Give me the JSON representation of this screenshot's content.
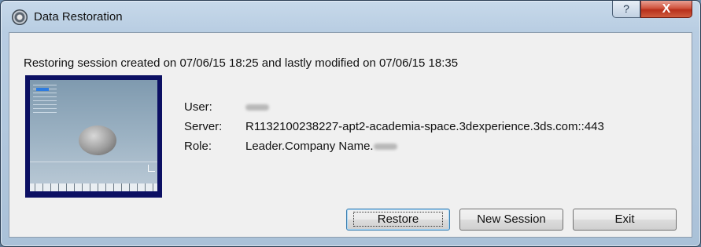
{
  "window": {
    "title": "Data Restoration",
    "help_label": "?",
    "close_label": "X"
  },
  "message": "Restoring session created on 07/06/15 18:25 and lastly modified on 07/06/15 18:35",
  "info": {
    "user_label": "User:",
    "server_label": "Server:",
    "server_value": "R1132100238227-apt2-academia-space.3dexperience.3ds.com::443",
    "role_label": "Role:",
    "role_value": "Leader.Company Name."
  },
  "buttons": {
    "restore": "Restore",
    "new_session": "New Session",
    "exit": "Exit"
  },
  "colors": {
    "close_red": "#c7402a",
    "preview_bg": "#0c1063",
    "default_button_border": "#3c7fb1"
  }
}
